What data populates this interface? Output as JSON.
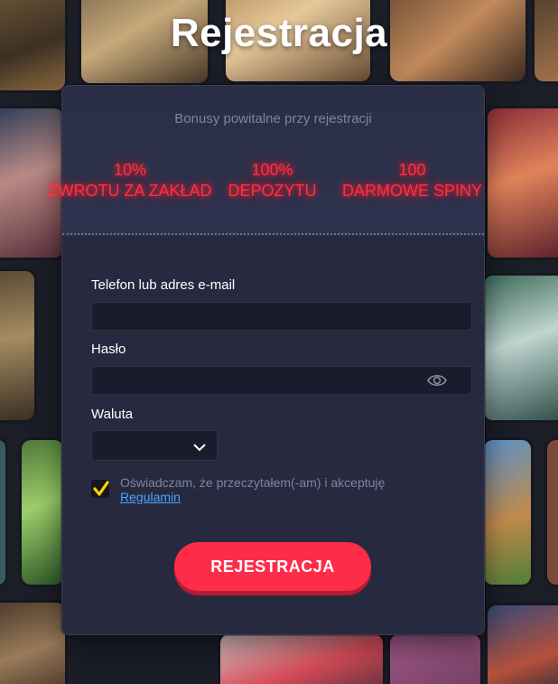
{
  "page": {
    "title": "Rejestracja"
  },
  "bonuses": {
    "heading": "Bonusy powitalne przy rejestracji",
    "items": [
      {
        "value": "10%",
        "label": "ZWROTU ZA ZAKŁAD"
      },
      {
        "value": "100%",
        "label": "DEPOZYTU"
      },
      {
        "value": "100",
        "label": "DARMOWE SPINY"
      }
    ]
  },
  "form": {
    "contact_label": "Telefon lub adres e-mail",
    "contact_value": "",
    "password_label": "Hasło",
    "password_value": "",
    "currency_label": "Waluta",
    "currency_value": "",
    "consent_text": "Oświadczam, że przeczytałem(-am) i akceptuję",
    "consent_link": "Regulamin",
    "consent_checked": true,
    "submit_label": "REJESTRACJA"
  },
  "colors": {
    "accent": "#ff2c49",
    "bonus_glow": "#ff3040",
    "checkbox_check": "#ffd400",
    "link": "#4aa3ff",
    "card": "#272a3f"
  },
  "icons": [
    "eye-icon",
    "chevron-down-icon",
    "checkmark-icon"
  ]
}
